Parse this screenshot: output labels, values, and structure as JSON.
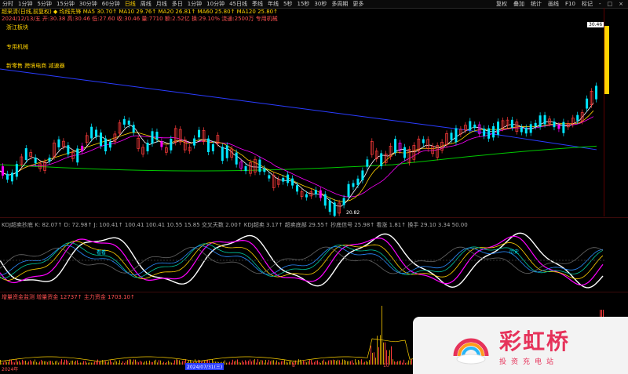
{
  "topbar": {
    "tabs": [
      "分时",
      "1分钟",
      "5分钟",
      "15分钟",
      "30分钟",
      "60分钟",
      "日线",
      "周线",
      "月线",
      "多日",
      "1分钟",
      "10分钟",
      "45日线",
      "季线",
      "年线",
      "5秒",
      "15秒",
      "30秒",
      "多周期",
      "更多"
    ],
    "active_index": 6,
    "right_menu": [
      "复权",
      "叠加",
      "统计",
      "画线",
      "F10",
      "标记",
      "-",
      "□",
      "×"
    ]
  },
  "quote": {
    "line1": "超采清(日线,前复权)  ◆ 均线先锋  MA5 30.70↑  MA10 29.76↑  MA20 26.81↑  MA60 25.80↑  MA120 25.80↑",
    "line2": "2024/12/13/五 开:30.38 高:30.46 低:27.60 收:30.46 量:7710 额:2.52亿 换:29.10% 流通:2500万  专用机械",
    "sector_labels": [
      "浙江板块",
      "专用机械",
      "新零售 跨境电商 减速器"
    ]
  },
  "price_axis": {
    "high_label": "30.46",
    "low_label": "20.82",
    "ticks": []
  },
  "kdj": {
    "header": "KDJ超卖抄底  K: 82.07↑  D: 72.98↑  J: 100.41↑  100.41  100.41  10.55  15.85  交叉天数 2.00↑  KDJ超卖 3.17↑  超卖底部 29.55↑  抄底信号 25.98↑  看涨 1.81↑  换手 29.10  3.34  50.00",
    "labels": {
      "buy1": "看看",
      "buy2": "历史"
    }
  },
  "volume": {
    "header": "增量资金监测  增量资金 12737↑  主力资金 1703.10↑"
  },
  "bottom": {
    "left_date": "2024年",
    "mid_date": "2024/07/31(三)",
    "marker": "8",
    "marker2": "10"
  },
  "watermark": {
    "brand": "彩虹桥",
    "slogan": "投资充电站"
  },
  "colors": {
    "up": "#ff3b3b",
    "down": "#00e6ff",
    "ma5": "#ffffff",
    "ma10": "#ffd200",
    "ma20": "#ff00ff",
    "ma60": "#00c800",
    "ma120": "#2a3cff",
    "accent": "#ffd200"
  }
}
